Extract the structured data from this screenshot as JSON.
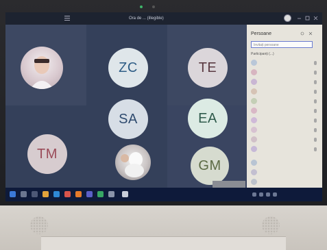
{
  "window": {
    "title": "Ora de ... (illegible)"
  },
  "video_grid": {
    "tiles": [
      {
        "initials": "ZC",
        "bg": "#dfe6ea",
        "fg": "#2f5d86"
      },
      {
        "initials": "TE",
        "bg": "#dbd6da",
        "fg": "#5a3a42"
      },
      {
        "initials": "SA",
        "bg": "#d7dee6",
        "fg": "#2f4b6f"
      },
      {
        "initials": "EA",
        "bg": "#dcebe4",
        "fg": "#2f5b4c"
      },
      {
        "initials": "TM",
        "bg": "#d7cccf",
        "fg": "#9a4b59"
      },
      {
        "initials": "GM",
        "bg": "#d6dbcf",
        "fg": "#5c6a45"
      }
    ]
  },
  "participants_panel": {
    "header": "Persoane",
    "search_placeholder": "Invitați persoane",
    "section_label": "Participanți (...)"
  },
  "colors": {
    "screen_bg": "#2b3344",
    "panel_bg": "#e7e4dc",
    "taskbar_bg": "#0e1a3a",
    "accent": "#6a7bd0"
  }
}
